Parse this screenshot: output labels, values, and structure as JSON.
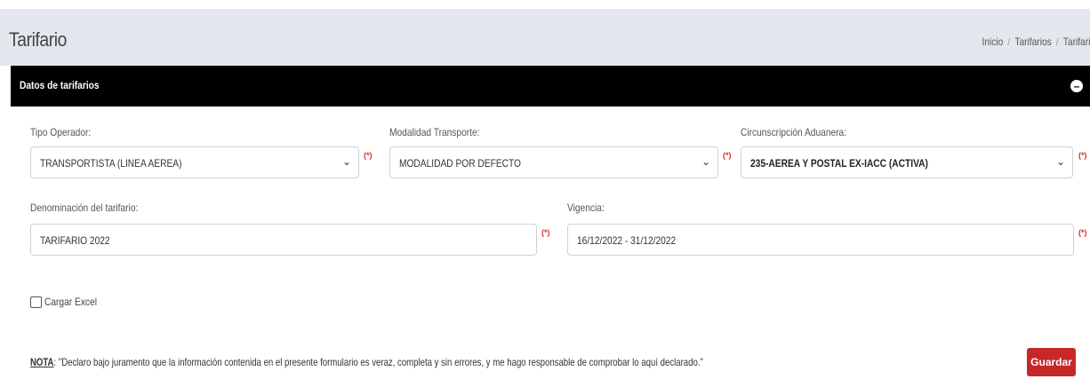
{
  "header": {
    "title": "Tarifario",
    "breadcrumb": [
      "Inicio",
      "Tarifarios",
      "Tarifari"
    ]
  },
  "panel": {
    "title": "Datos de tarifarios",
    "toggle_icon": "collapse-circle-icon"
  },
  "form": {
    "tipo_operador": {
      "label": "Tipo Operador:",
      "value": "TRANSPORTISTA  (LINEA AEREA)",
      "required": "(*)"
    },
    "modalidad": {
      "label": "Modalidad Transporte:",
      "value": "MODALIDAD POR DEFECTO",
      "required": "(*)"
    },
    "circunscripcion": {
      "label": "Circunscripción Aduanera:",
      "value": "235-AEREA  Y POSTAL EX-IACC (ACTIVA)",
      "required": "(*)"
    },
    "denominacion": {
      "label": "Denominación del tarifario:",
      "value": "TARIFARIO 2022",
      "required": "(*)"
    },
    "vigencia": {
      "label": "Vigencia:",
      "value": "16/12/2022 - 31/12/2022",
      "required": "(*)"
    },
    "cargar_excel": {
      "label": "Cargar Excel",
      "checked": false
    }
  },
  "note": {
    "key": "NOTA",
    "text": ": \"Declaro bajo juramento que la información contenida en el presente formulario es veraz, completa y sin errores, y me hago responsable de comprobar lo aquí declarado.\""
  },
  "actions": {
    "save_label": "Guardar"
  },
  "colors": {
    "header_bg": "#e4e8ee",
    "panel_bar": "#000000",
    "required": "#d32f2f",
    "save_button": "#c62828"
  }
}
